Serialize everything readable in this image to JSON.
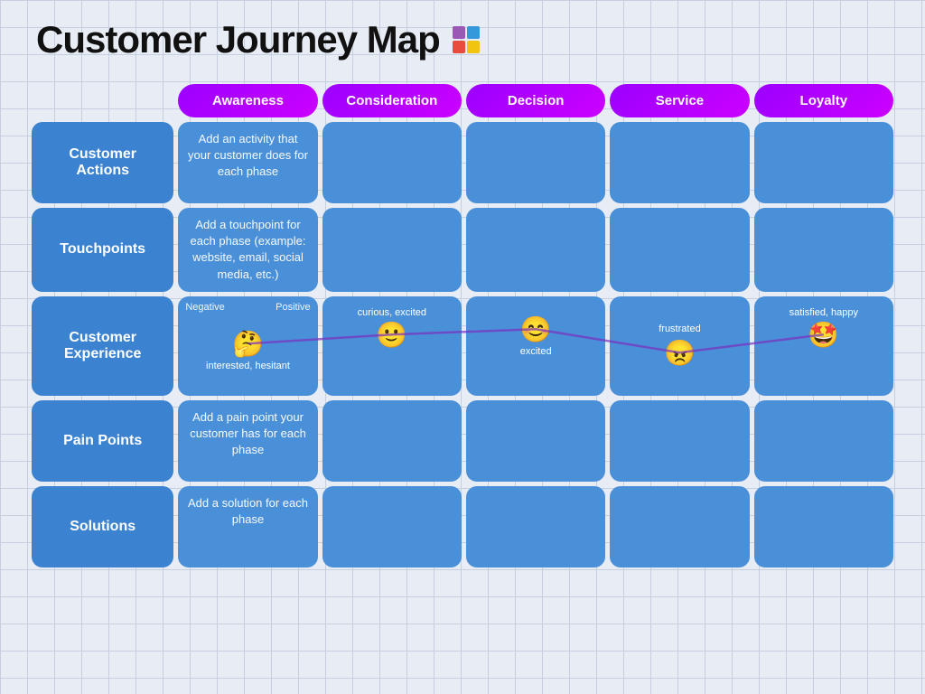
{
  "title": "Customer Journey Map",
  "phases": [
    "Awareness",
    "Consideration",
    "Decision",
    "Service",
    "Loyalty"
  ],
  "rows": [
    {
      "label": "Customer Actions",
      "cells": [
        {
          "hint": "Add an activity that your customer does for each phase"
        },
        {
          "hint": ""
        },
        {
          "hint": ""
        },
        {
          "hint": ""
        },
        {
          "hint": ""
        }
      ]
    },
    {
      "label": "Touchpoints",
      "cells": [
        {
          "hint": "Add a touchpoint for each phase (example: website, email, social media, etc.)"
        },
        {
          "hint": ""
        },
        {
          "hint": ""
        },
        {
          "hint": ""
        },
        {
          "hint": ""
        }
      ]
    },
    {
      "label": "Customer Experience",
      "isExperience": true,
      "cells": [
        {
          "negLabel": "Negative",
          "posLabel": "Positive",
          "emoji": "🤔",
          "emotionText": "interested, hesitant",
          "valign": "bottom"
        },
        {
          "emoji": "🙂",
          "emotionText": "curious, excited",
          "valign": "top"
        },
        {
          "emoji": "😊",
          "emotionText": "excited",
          "valign": "top"
        },
        {
          "emoji": "😠",
          "emotionText": "frustrated",
          "valign": "bottom"
        },
        {
          "emoji": "🤩",
          "emotionText": "satisfied, happy",
          "valign": "top"
        }
      ]
    },
    {
      "label": "Pain Points",
      "cells": [
        {
          "hint": "Add a pain point your customer has for each phase"
        },
        {
          "hint": ""
        },
        {
          "hint": ""
        },
        {
          "hint": ""
        },
        {
          "hint": ""
        }
      ]
    },
    {
      "label": "Solutions",
      "cells": [
        {
          "hint": "Add a solution for each phase"
        },
        {
          "hint": ""
        },
        {
          "hint": ""
        },
        {
          "hint": ""
        },
        {
          "hint": ""
        }
      ]
    }
  ],
  "logo": {
    "squares": [
      [
        "purple",
        "blue"
      ],
      [
        "red",
        "yellow"
      ]
    ]
  }
}
